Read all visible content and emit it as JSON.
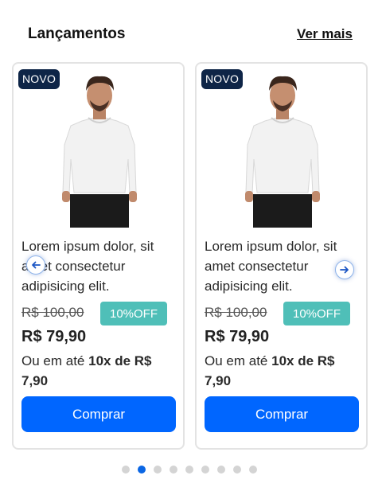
{
  "header": {
    "title": "Lançamentos",
    "see_more": "Ver mais"
  },
  "products": [
    {
      "badge": "NOVO",
      "description": "Lorem ipsum dolor, sit amet consectetur adipisicing elit.",
      "old_price": "R$ 100,00",
      "discount": "10%OFF",
      "price": "R$ 79,90",
      "installment_prefix": "Ou em até ",
      "installment_bold": "10x de R$ 7,90",
      "buy_label": "Comprar"
    },
    {
      "badge": "NOVO",
      "description": "Lorem ipsum dolor, sit amet consectetur adipisicing elit.",
      "old_price": "R$ 100,00",
      "discount": "10%OFF",
      "price": "R$ 79,90",
      "installment_prefix": "Ou em até ",
      "installment_bold": "10x de R$ 7,90",
      "buy_label": "Comprar"
    }
  ],
  "carousel": {
    "prev_icon": "arrow-left-icon",
    "next_icon": "arrow-right-icon",
    "dot_count": 9,
    "active_dot": 2
  },
  "colors": {
    "badge_bg": "#0e2547",
    "discount_bg": "#4fbfb8",
    "button_bg": "#0066ff",
    "dot_active": "#0a66e4",
    "dot_inactive": "#d4d4d4"
  }
}
